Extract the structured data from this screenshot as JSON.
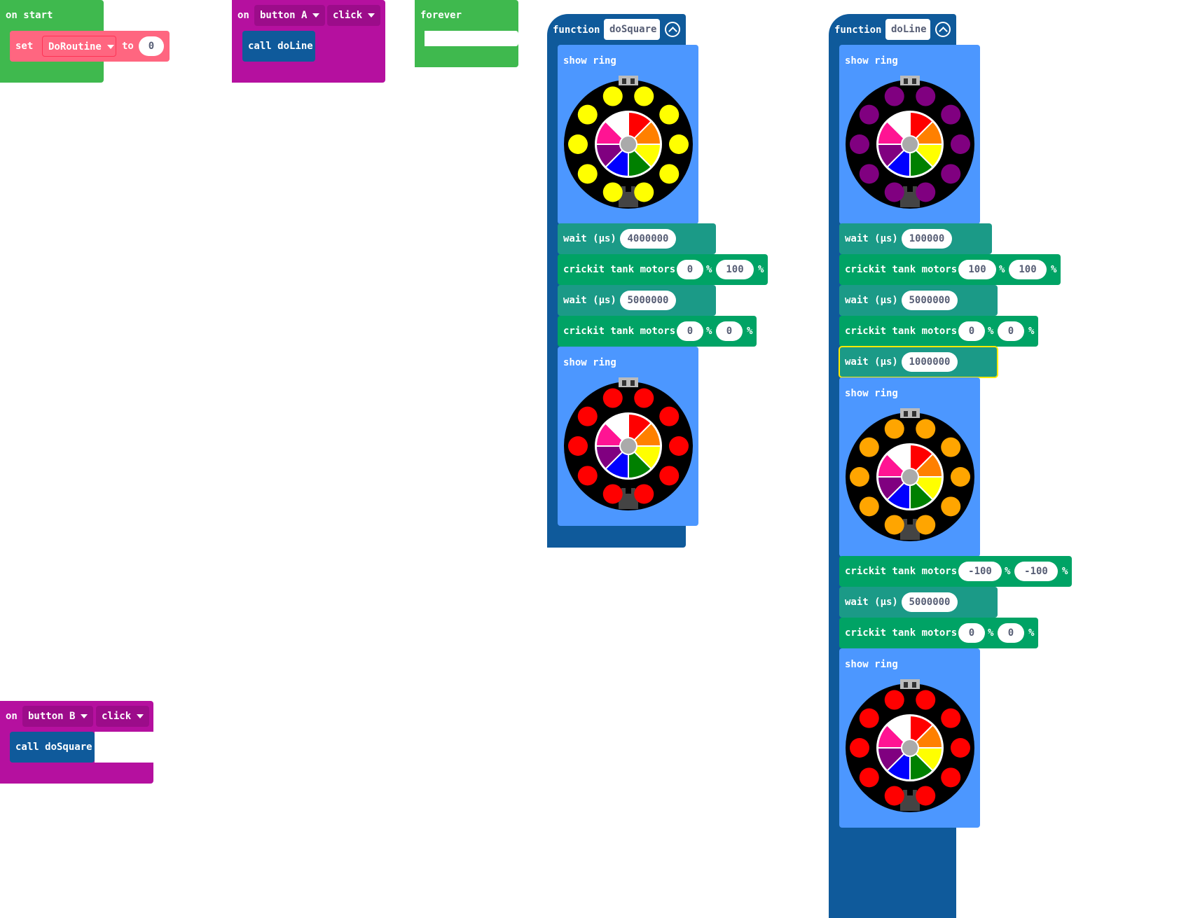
{
  "on_start": {
    "hat_label": "on start",
    "set_label": "set",
    "variable": "DoRoutine",
    "to_label": "to",
    "value": "0"
  },
  "button_a": {
    "on_label": "on",
    "button": "button A",
    "event": "click",
    "call_label": "call doLine"
  },
  "forever": {
    "label": "forever"
  },
  "button_b": {
    "on_label": "on",
    "button": "button B",
    "event": "click",
    "call_label": "call doSquare"
  },
  "do_square": {
    "keyword": "function",
    "name": "doSquare",
    "blocks": [
      {
        "type": "show_ring",
        "label": "show ring",
        "outer_color": "#ffff00"
      },
      {
        "type": "wait",
        "label": "wait (µs)",
        "value": "4000000"
      },
      {
        "type": "motors",
        "label": "crickit tank motors",
        "left": "0",
        "right": "100",
        "unit": "%"
      },
      {
        "type": "wait",
        "label": "wait (µs)",
        "value": "5000000"
      },
      {
        "type": "motors",
        "label": "crickit tank motors",
        "left": "0",
        "right": "0",
        "unit": "%"
      },
      {
        "type": "show_ring",
        "label": "show ring",
        "outer_color": "#ff0000"
      }
    ]
  },
  "do_line": {
    "keyword": "function",
    "name": "doLine",
    "blocks": [
      {
        "type": "show_ring",
        "label": "show ring",
        "outer_color": "#800080"
      },
      {
        "type": "wait",
        "label": "wait (µs)",
        "value": "100000"
      },
      {
        "type": "motors",
        "label": "crickit tank motors",
        "left": "100",
        "right": "100",
        "unit": "%"
      },
      {
        "type": "wait",
        "label": "wait (µs)",
        "value": "5000000"
      },
      {
        "type": "motors",
        "label": "crickit tank motors",
        "left": "0",
        "right": "0",
        "unit": "%"
      },
      {
        "type": "wait",
        "label": "wait (µs)",
        "value": "1000000",
        "selected": true
      },
      {
        "type": "show_ring",
        "label": "show ring",
        "outer_color": "#ffa500"
      },
      {
        "type": "motors",
        "label": "crickit tank motors",
        "left": "-100",
        "right": "-100",
        "unit": "%"
      },
      {
        "type": "wait",
        "label": "wait (µs)",
        "value": "5000000"
      },
      {
        "type": "motors",
        "label": "crickit tank motors",
        "left": "0",
        "right": "0",
        "unit": "%"
      },
      {
        "type": "show_ring",
        "label": "show ring",
        "outer_color": "#ff0000"
      }
    ]
  },
  "palette": {
    "wheel": [
      "#ff0000",
      "#ff8000",
      "#ffff00",
      "#008000",
      "#0000ff",
      "#800080",
      "#ff1493",
      "#ffffff"
    ]
  }
}
